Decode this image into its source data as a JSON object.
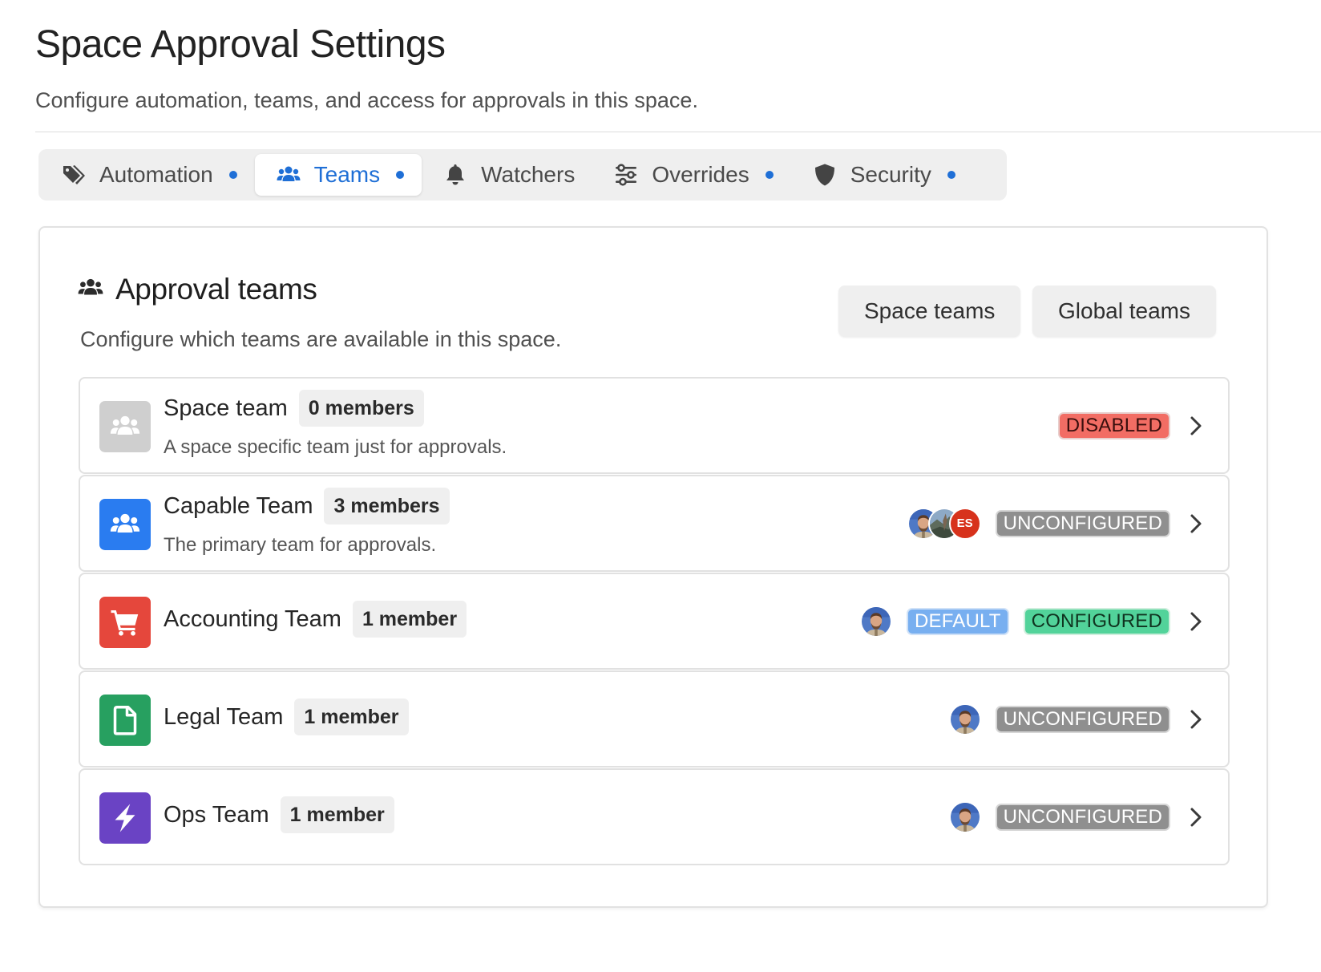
{
  "page": {
    "title": "Space Approval Settings",
    "subtitle": "Configure automation, teams, and access for approvals in this space."
  },
  "tabs": [
    {
      "label": "Automation",
      "icon": "tag-icon",
      "active": false,
      "dot": true
    },
    {
      "label": "Teams",
      "icon": "users-icon",
      "active": true,
      "dot": true
    },
    {
      "label": "Watchers",
      "icon": "bell-icon",
      "active": false,
      "dot": false
    },
    {
      "label": "Overrides",
      "icon": "sliders-icon",
      "active": false,
      "dot": true
    },
    {
      "label": "Security",
      "icon": "shield-icon",
      "active": false,
      "dot": true
    }
  ],
  "panel": {
    "title": "Approval teams",
    "description": "Configure which teams are available in this space.",
    "space_teams_label": "Space teams",
    "global_teams_label": "Global teams"
  },
  "teams": [
    {
      "name": "Space team",
      "members": "0 members",
      "description": "A space specific team just for approvals.",
      "icon": "users-icon",
      "icon_color": "#cfcfcf",
      "avatars": [],
      "badges": [
        {
          "label": "DISABLED",
          "kind": "disabled"
        }
      ]
    },
    {
      "name": "Capable Team",
      "members": "3 members",
      "description": "The primary team for approvals.",
      "icon": "users-icon",
      "icon_color": "#2a7cf0",
      "avatars": [
        "photo",
        "photo-landscape",
        "ES"
      ],
      "badges": [
        {
          "label": "UNCONFIGURED",
          "kind": "unconfigured"
        }
      ]
    },
    {
      "name": "Accounting Team",
      "members": "1 member",
      "description": "",
      "icon": "cart-icon",
      "icon_color": "#e5473c",
      "avatars": [
        "photo"
      ],
      "badges": [
        {
          "label": "DEFAULT",
          "kind": "default"
        },
        {
          "label": "CONFIGURED",
          "kind": "configured"
        }
      ]
    },
    {
      "name": "Legal Team",
      "members": "1 member",
      "description": "",
      "icon": "file-icon",
      "icon_color": "#27a060",
      "avatars": [
        "photo"
      ],
      "badges": [
        {
          "label": "UNCONFIGURED",
          "kind": "unconfigured"
        }
      ]
    },
    {
      "name": "Ops Team",
      "members": "1 member",
      "description": "",
      "icon": "bolt-icon",
      "icon_color": "#6a43c4",
      "avatars": [
        "photo"
      ],
      "badges": [
        {
          "label": "UNCONFIGURED",
          "kind": "unconfigured"
        }
      ]
    }
  ],
  "colors": {
    "accent": "#1f6fd6",
    "disabled": "#f26d64",
    "unconfigured": "#8f8f8f",
    "default": "#78aff0",
    "configured": "#52d39a"
  }
}
